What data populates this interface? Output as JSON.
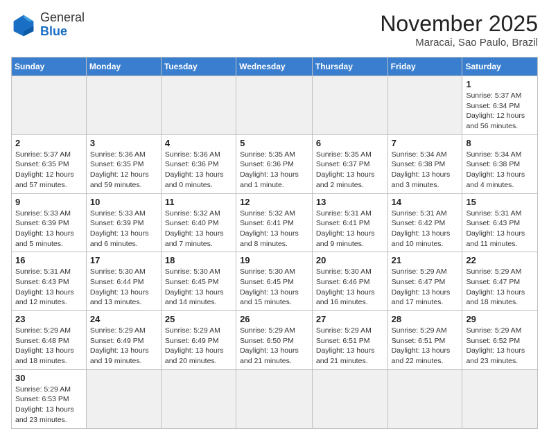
{
  "header": {
    "logo_general": "General",
    "logo_blue": "Blue",
    "month_title": "November 2025",
    "location": "Maracai, Sao Paulo, Brazil"
  },
  "weekdays": [
    "Sunday",
    "Monday",
    "Tuesday",
    "Wednesday",
    "Thursday",
    "Friday",
    "Saturday"
  ],
  "weeks": [
    [
      {
        "day": "",
        "info": ""
      },
      {
        "day": "",
        "info": ""
      },
      {
        "day": "",
        "info": ""
      },
      {
        "day": "",
        "info": ""
      },
      {
        "day": "",
        "info": ""
      },
      {
        "day": "",
        "info": ""
      },
      {
        "day": "1",
        "info": "Sunrise: 5:37 AM\nSunset: 6:34 PM\nDaylight: 12 hours\nand 56 minutes."
      }
    ],
    [
      {
        "day": "2",
        "info": "Sunrise: 5:37 AM\nSunset: 6:35 PM\nDaylight: 12 hours\nand 57 minutes."
      },
      {
        "day": "3",
        "info": "Sunrise: 5:36 AM\nSunset: 6:35 PM\nDaylight: 12 hours\nand 59 minutes."
      },
      {
        "day": "4",
        "info": "Sunrise: 5:36 AM\nSunset: 6:36 PM\nDaylight: 13 hours\nand 0 minutes."
      },
      {
        "day": "5",
        "info": "Sunrise: 5:35 AM\nSunset: 6:36 PM\nDaylight: 13 hours\nand 1 minute."
      },
      {
        "day": "6",
        "info": "Sunrise: 5:35 AM\nSunset: 6:37 PM\nDaylight: 13 hours\nand 2 minutes."
      },
      {
        "day": "7",
        "info": "Sunrise: 5:34 AM\nSunset: 6:38 PM\nDaylight: 13 hours\nand 3 minutes."
      },
      {
        "day": "8",
        "info": "Sunrise: 5:34 AM\nSunset: 6:38 PM\nDaylight: 13 hours\nand 4 minutes."
      }
    ],
    [
      {
        "day": "9",
        "info": "Sunrise: 5:33 AM\nSunset: 6:39 PM\nDaylight: 13 hours\nand 5 minutes."
      },
      {
        "day": "10",
        "info": "Sunrise: 5:33 AM\nSunset: 6:39 PM\nDaylight: 13 hours\nand 6 minutes."
      },
      {
        "day": "11",
        "info": "Sunrise: 5:32 AM\nSunset: 6:40 PM\nDaylight: 13 hours\nand 7 minutes."
      },
      {
        "day": "12",
        "info": "Sunrise: 5:32 AM\nSunset: 6:41 PM\nDaylight: 13 hours\nand 8 minutes."
      },
      {
        "day": "13",
        "info": "Sunrise: 5:31 AM\nSunset: 6:41 PM\nDaylight: 13 hours\nand 9 minutes."
      },
      {
        "day": "14",
        "info": "Sunrise: 5:31 AM\nSunset: 6:42 PM\nDaylight: 13 hours\nand 10 minutes."
      },
      {
        "day": "15",
        "info": "Sunrise: 5:31 AM\nSunset: 6:43 PM\nDaylight: 13 hours\nand 11 minutes."
      }
    ],
    [
      {
        "day": "16",
        "info": "Sunrise: 5:31 AM\nSunset: 6:43 PM\nDaylight: 13 hours\nand 12 minutes."
      },
      {
        "day": "17",
        "info": "Sunrise: 5:30 AM\nSunset: 6:44 PM\nDaylight: 13 hours\nand 13 minutes."
      },
      {
        "day": "18",
        "info": "Sunrise: 5:30 AM\nSunset: 6:45 PM\nDaylight: 13 hours\nand 14 minutes."
      },
      {
        "day": "19",
        "info": "Sunrise: 5:30 AM\nSunset: 6:45 PM\nDaylight: 13 hours\nand 15 minutes."
      },
      {
        "day": "20",
        "info": "Sunrise: 5:30 AM\nSunset: 6:46 PM\nDaylight: 13 hours\nand 16 minutes."
      },
      {
        "day": "21",
        "info": "Sunrise: 5:29 AM\nSunset: 6:47 PM\nDaylight: 13 hours\nand 17 minutes."
      },
      {
        "day": "22",
        "info": "Sunrise: 5:29 AM\nSunset: 6:47 PM\nDaylight: 13 hours\nand 18 minutes."
      }
    ],
    [
      {
        "day": "23",
        "info": "Sunrise: 5:29 AM\nSunset: 6:48 PM\nDaylight: 13 hours\nand 18 minutes."
      },
      {
        "day": "24",
        "info": "Sunrise: 5:29 AM\nSunset: 6:49 PM\nDaylight: 13 hours\nand 19 minutes."
      },
      {
        "day": "25",
        "info": "Sunrise: 5:29 AM\nSunset: 6:49 PM\nDaylight: 13 hours\nand 20 minutes."
      },
      {
        "day": "26",
        "info": "Sunrise: 5:29 AM\nSunset: 6:50 PM\nDaylight: 13 hours\nand 21 minutes."
      },
      {
        "day": "27",
        "info": "Sunrise: 5:29 AM\nSunset: 6:51 PM\nDaylight: 13 hours\nand 21 minutes."
      },
      {
        "day": "28",
        "info": "Sunrise: 5:29 AM\nSunset: 6:51 PM\nDaylight: 13 hours\nand 22 minutes."
      },
      {
        "day": "29",
        "info": "Sunrise: 5:29 AM\nSunset: 6:52 PM\nDaylight: 13 hours\nand 23 minutes."
      }
    ],
    [
      {
        "day": "30",
        "info": "Sunrise: 5:29 AM\nSunset: 6:53 PM\nDaylight: 13 hours\nand 23 minutes."
      },
      {
        "day": "",
        "info": ""
      },
      {
        "day": "",
        "info": ""
      },
      {
        "day": "",
        "info": ""
      },
      {
        "day": "",
        "info": ""
      },
      {
        "day": "",
        "info": ""
      },
      {
        "day": "",
        "info": ""
      }
    ]
  ]
}
